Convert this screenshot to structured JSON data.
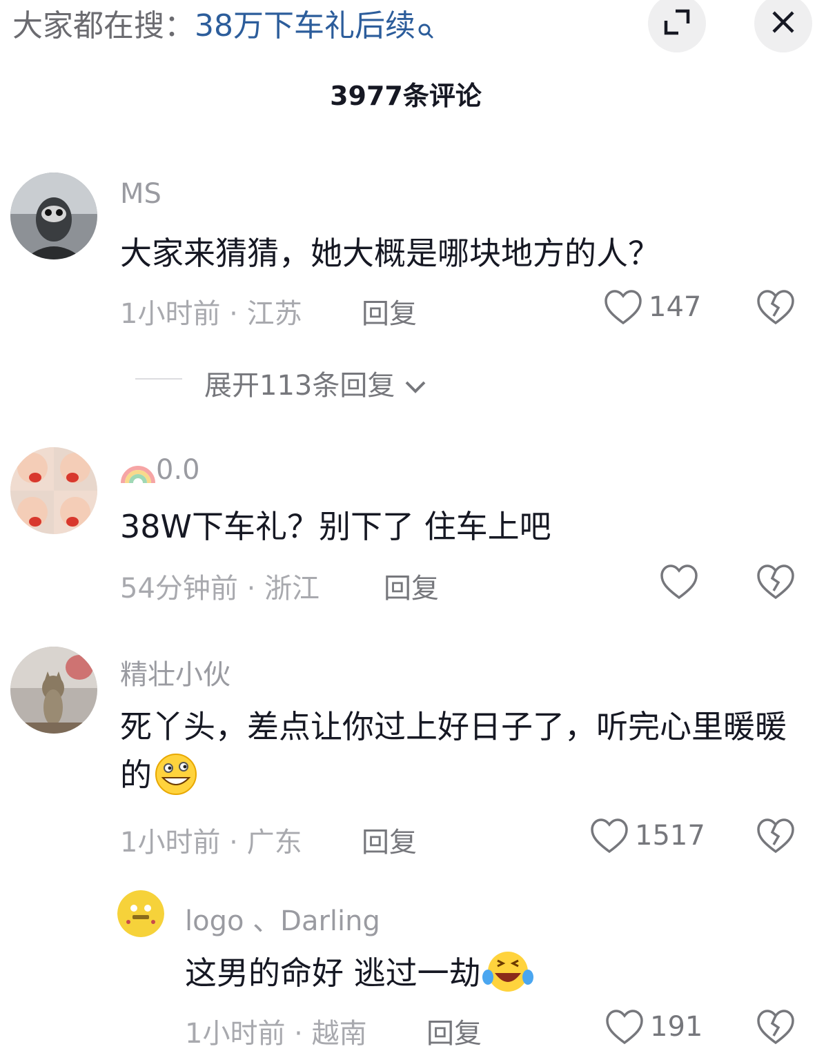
{
  "header": {
    "search_prefix": "大家都在搜：",
    "search_query": "38万下车礼后续",
    "comment_count": "3977条评论"
  },
  "comments": [
    {
      "username": "MS",
      "text": "大家来猜猜，她大概是哪块地方的人？",
      "time": "1小时前",
      "location": "江苏",
      "reply_label": "回复",
      "likes": "147",
      "expand_label": "展开113条回复"
    },
    {
      "username_emoji": "rainbow",
      "username": "0.0",
      "text": "38W下车礼？别下了 住车上吧",
      "time": "54分钟前",
      "location": "浙江",
      "reply_label": "回复",
      "likes": ""
    },
    {
      "username": "精壮小伙",
      "text": "死丫头，差点让你过上好日子了，听完心里暖暖的",
      "emoji": "grin-emoji",
      "time": "1小时前",
      "location": "广东",
      "reply_label": "回复",
      "likes": "1517"
    }
  ],
  "reply": {
    "username": "logo 、Darling",
    "text": "这男的命好 逃过一劫",
    "emoji": "laugh-cry-emoji",
    "time": "1小时前",
    "location": "越南",
    "reply_label": "回复",
    "likes": "191"
  },
  "colors": {
    "search_query": "#2c5d9b",
    "text_primary": "#161823",
    "text_secondary": "#a8a9ae"
  }
}
